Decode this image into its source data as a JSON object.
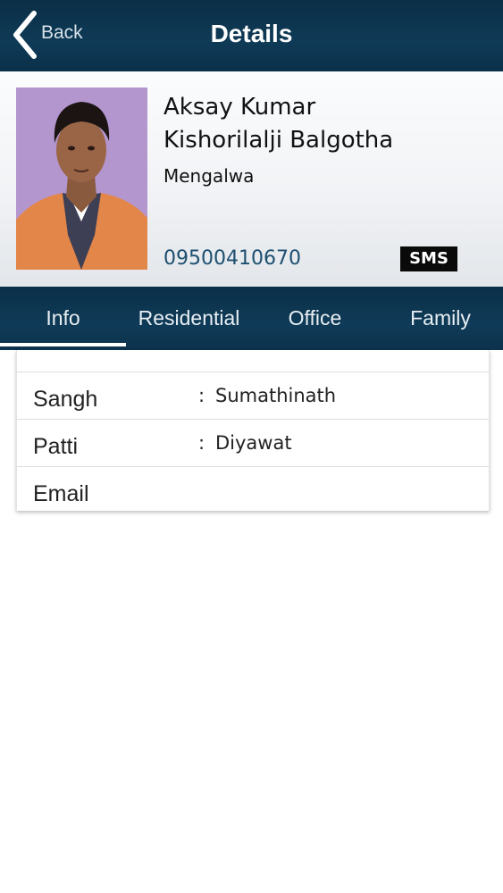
{
  "navbar": {
    "back_label": "Back",
    "title": "Details"
  },
  "profile": {
    "name_line1": "Aksay Kumar",
    "name_line2": "Kishorilalji Balgotha",
    "place": "Mengalwa",
    "phone": "09500410670",
    "sms_label": "SMS"
  },
  "tabs": [
    {
      "label": "Info",
      "selected": true
    },
    {
      "label": "Residential",
      "selected": false
    },
    {
      "label": "Office",
      "selected": false
    },
    {
      "label": "Family",
      "selected": false
    }
  ],
  "details": [
    {
      "label": "Sangh",
      "colon": ":",
      "value": "Sumathinath"
    },
    {
      "label": "Patti",
      "colon": ":",
      "value": "Diyawat"
    },
    {
      "label": "Email",
      "colon": "",
      "value": ""
    }
  ],
  "colors": {
    "navbar_bg": "#0e3a56",
    "phone_text": "#1d4f70",
    "sms_bg": "#0a0a0a",
    "photo_bg": "#b496cf"
  },
  "icons": {
    "back": "chevron-left-icon",
    "photo": "avatar-photo"
  }
}
